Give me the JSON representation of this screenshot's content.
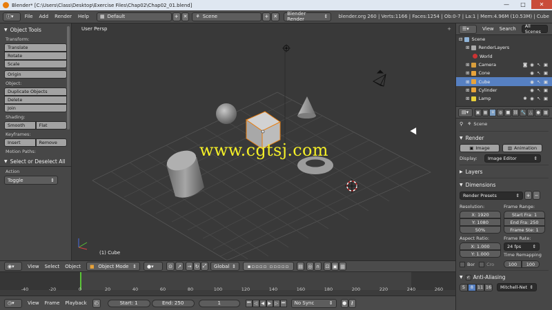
{
  "window": {
    "title": "Blender* [C:\\Users\\Class\\Desktop\\Exercise Files\\Chap02\\Chap02_01.blend]",
    "minimize": "—",
    "maximize": "□",
    "close": "✕"
  },
  "info": {
    "menus": [
      "File",
      "Add",
      "Render",
      "Help"
    ],
    "layout": "Default",
    "scene": "Scene",
    "engine": "Blender Render",
    "stats": "blender.org 260 | Verts:1166 | Faces:1254 | Ob:0-7 | La:1 | Mem:4.96M (10.53M) | Cube"
  },
  "toolshelf": {
    "title": "Object Tools",
    "transform_label": "Transform:",
    "translate": "Translate",
    "rotate": "Rotate",
    "scale": "Scale",
    "origin": "Origin",
    "object_label": "Object:",
    "duplicate": "Duplicate Objects",
    "delete": "Delete",
    "join": "Join",
    "shading_label": "Shading:",
    "smooth": "Smooth",
    "flat": "Flat",
    "keyframes_label": "Keyframes:",
    "insert": "Insert",
    "remove": "Remove",
    "motion_label": "Motion Paths:",
    "operator_title": "Select or Deselect All",
    "action_label": "Action",
    "action_value": "Toggle"
  },
  "viewport": {
    "label": "User Persp",
    "active_object": "(1) Cube",
    "watermark": "www.cgtsj.com"
  },
  "view_header": {
    "menus": [
      "View",
      "Select",
      "Object"
    ],
    "mode": "Object Mode",
    "orientation": "Global"
  },
  "timeline": {
    "ticks": [
      "-40",
      "-20",
      "0",
      "20",
      "40",
      "60",
      "80",
      "100",
      "120",
      "140",
      "160",
      "180",
      "200",
      "220",
      "240",
      "260"
    ],
    "current_frame": 1,
    "menus": [
      "View",
      "Frame",
      "Playback"
    ],
    "start": "Start: 1",
    "end": "End: 250",
    "frame": "1",
    "sync": "No Sync"
  },
  "outliner": {
    "menus": [
      "View",
      "Search"
    ],
    "filter": "All Scenes",
    "items": [
      {
        "name": "Scene"
      },
      {
        "name": "RenderLayers"
      },
      {
        "name": "World"
      },
      {
        "name": "Camera"
      },
      {
        "name": "Cone"
      },
      {
        "name": "Cube"
      },
      {
        "name": "Cylinder"
      },
      {
        "name": "Lamp"
      }
    ]
  },
  "properties": {
    "context": "Scene",
    "render_title": "Render",
    "image_btn": "Image",
    "animation_btn": "Animation",
    "display_label": "Display:",
    "display_value": "Image Editor",
    "layers_title": "Layers",
    "dimensions_title": "Dimensions",
    "presets": "Render Presets",
    "resolution_label": "Resolution:",
    "res_x": "X: 1920",
    "res_y": "Y: 1080",
    "res_pct": "50%",
    "frame_range_label": "Frame Range:",
    "fr_start": "Start Fra: 1",
    "fr_end": "End Fra: 250",
    "fr_step": "Frame Ste: 1",
    "aspect_label": "Aspect Ratio:",
    "asp_x": "X: 1.000",
    "asp_y": "Y: 1.000",
    "frame_rate_label": "Frame Rate:",
    "fps": "24 fps",
    "remap_label": "Time Remapping",
    "remap_old": "100",
    "remap_new": "100",
    "bor": "Bor",
    "cro": "Cro",
    "aa_title": "Anti-Aliasing",
    "aa_samples": [
      "5",
      "8",
      "11",
      "16"
    ],
    "aa_active": "8",
    "aa_filter": "Mitchell-Net"
  },
  "colors": {
    "accent_orange": "#e87d0d",
    "selected_blue": "#5680c2",
    "watermark": "#f4ef28",
    "timeline_cursor": "#5ac537"
  }
}
